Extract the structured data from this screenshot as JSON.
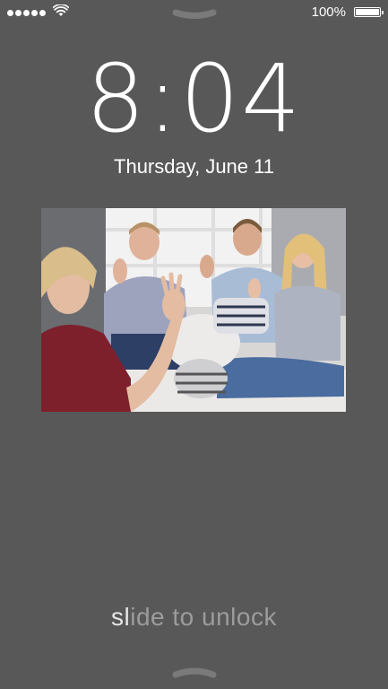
{
  "status_bar": {
    "signal_dots": 5,
    "battery_label": "100%",
    "battery_level": 1.0
  },
  "lock_screen": {
    "time": "8:04",
    "date": "Thursday, June 11",
    "slide_text": "slide to unlock",
    "slide_highlight": "sl",
    "slide_rest": "ide to unlock"
  },
  "wallpaper": {
    "subject": "photo-people-signing"
  },
  "colors": {
    "background": "#585858",
    "text": "#ffffff",
    "unlock_dim": "#9c9c9c"
  }
}
